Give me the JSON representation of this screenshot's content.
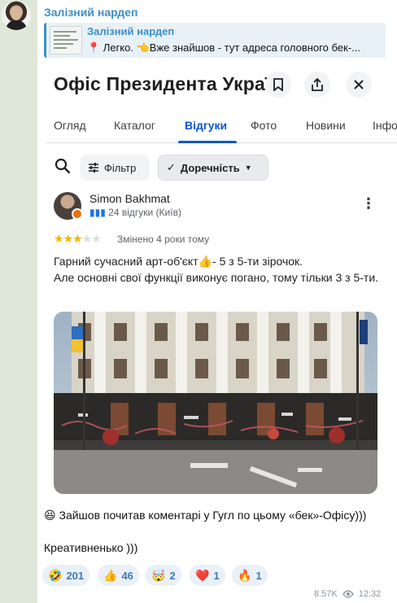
{
  "channel": {
    "sender": "Залізний нардеп"
  },
  "reply": {
    "title": "Залізний нардеп",
    "text": "📍 Легко. 👈Вже знайшов - тут адреса головного бек-..."
  },
  "screenshot": {
    "place_title": "Офіс Президента Украї...",
    "tabs": [
      "Огляд",
      "Каталог",
      "Відгуки",
      "Фото",
      "Новини",
      "Інфо"
    ],
    "active_tab": "Відгуки",
    "filter_label": "Фільтр",
    "sort_label": "Доречність",
    "review": {
      "author": "Simon Bakhmat",
      "author_meta": "24 відгуки (Київ)",
      "rating": 3,
      "rating_max": 5,
      "date": "Змінено 4 роки тому",
      "text": "Гарний сучасний арт-об'єкт👍- 5 з 5-ти зірочок.\nАле основні свої функції виконує погано, тому тільки 3 з 5-ти."
    }
  },
  "caption": "😆 Зайшов почитав коментарі у Гугл по цьому «бек»-Офісу)))\n\nКреативненько )))",
  "reactions": [
    {
      "emoji": "🤣",
      "count": "201"
    },
    {
      "emoji": "👍",
      "count": "46"
    },
    {
      "emoji": "🤯",
      "count": "2"
    },
    {
      "emoji": "❤️",
      "count": "1"
    },
    {
      "emoji": "🔥",
      "count": "1"
    }
  ],
  "views": "8.57K",
  "time": "12:32",
  "colors": {
    "accent": "#3d8fc9",
    "google_blue": "#0b57d0",
    "star": "#f4b400"
  }
}
